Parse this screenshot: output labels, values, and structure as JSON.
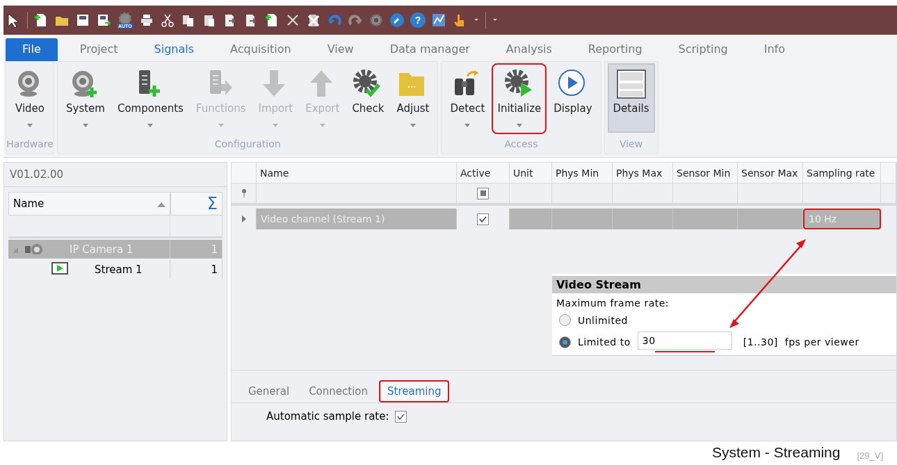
{
  "quick_access": {
    "auto_label": "AUTO",
    "help_label": "?"
  },
  "ribbon_tabs": [
    {
      "label": "File",
      "kind": "file",
      "selected": false
    },
    {
      "label": "Project",
      "kind": "tab",
      "selected": false
    },
    {
      "label": "Signals",
      "kind": "tab",
      "selected": true
    },
    {
      "label": "Acquisition",
      "kind": "tab",
      "selected": false
    },
    {
      "label": "View",
      "kind": "tab",
      "selected": false
    },
    {
      "label": "Data manager",
      "kind": "tab",
      "selected": false
    },
    {
      "label": "Analysis",
      "kind": "tab",
      "selected": false
    },
    {
      "label": "Reporting",
      "kind": "tab",
      "selected": false
    },
    {
      "label": "Scripting",
      "kind": "tab",
      "selected": false
    },
    {
      "label": "Info",
      "kind": "tab",
      "selected": false
    }
  ],
  "ribbon_groups": [
    {
      "label": "Hardware",
      "items": [
        {
          "label": "Video",
          "kind": "webcam",
          "dropdown": true,
          "disabled": false,
          "pressed": false,
          "highlighted": false
        }
      ]
    },
    {
      "label": "Configuration",
      "items": [
        {
          "label": "System",
          "kind": "webcam-add",
          "dropdown": true,
          "disabled": false,
          "pressed": false,
          "highlighted": false
        },
        {
          "label": "Components",
          "kind": "server-add",
          "dropdown": true,
          "disabled": false,
          "pressed": false,
          "highlighted": false
        },
        {
          "label": "Functions",
          "kind": "server-arrow",
          "dropdown": true,
          "disabled": true,
          "pressed": false,
          "highlighted": false
        },
        {
          "label": "Import",
          "kind": "arrow-down",
          "dropdown": true,
          "disabled": true,
          "pressed": false,
          "highlighted": false
        },
        {
          "label": "Export",
          "kind": "arrow-up",
          "dropdown": true,
          "disabled": true,
          "pressed": false,
          "highlighted": false
        },
        {
          "label": "Check",
          "kind": "gear-check",
          "dropdown": false,
          "disabled": false,
          "pressed": false,
          "highlighted": false
        },
        {
          "label": "Adjust",
          "kind": "folder",
          "dropdown": true,
          "disabled": false,
          "pressed": false,
          "highlighted": false
        }
      ]
    },
    {
      "label": "Access",
      "items": [
        {
          "label": "Detect",
          "kind": "binoculars",
          "dropdown": true,
          "disabled": false,
          "pressed": false,
          "highlighted": false
        },
        {
          "label": "Initialize",
          "kind": "gear-play",
          "dropdown": true,
          "disabled": false,
          "pressed": false,
          "highlighted": true
        },
        {
          "label": "Display",
          "kind": "play-circle",
          "dropdown": false,
          "disabled": false,
          "pressed": false,
          "highlighted": false
        }
      ]
    },
    {
      "label": "View",
      "items": [
        {
          "label": "Details",
          "kind": "details",
          "dropdown": false,
          "disabled": false,
          "pressed": true,
          "highlighted": false
        }
      ]
    }
  ],
  "tree": {
    "version": "V01.02.00",
    "name_column": "Name",
    "name_sorted_ascending": true,
    "count_column": "Σ",
    "rows": [
      {
        "name": "IP Camera 1",
        "count": "1",
        "kind": "camera",
        "selected": true,
        "expanded": true,
        "children": [
          {
            "name": "Stream 1",
            "count": "1",
            "kind": "stream",
            "selected": false
          }
        ]
      }
    ]
  },
  "channel_grid": {
    "columns": [
      "Name",
      "Active",
      "Unit",
      "Phys Min",
      "Phys Max",
      "Sensor Min",
      "Sensor Max",
      "Sampling rate"
    ],
    "active_filter_mixed": true,
    "rows": [
      {
        "name": "Video channel (Stream 1)",
        "active": true,
        "sampling_rate": "10 Hz",
        "selected": true,
        "sampling_rate_highlighted": true
      }
    ]
  },
  "video_stream_panel": {
    "title": "Video Stream",
    "label": "Maximum frame rate:",
    "options": [
      {
        "label": "Unlimited",
        "selected": false
      },
      {
        "label": "Limited to",
        "selected": true,
        "value": "30",
        "range": "[1..30]",
        "unit": "fps per viewer",
        "underlined": true
      }
    ]
  },
  "detail_tabs": [
    {
      "label": "General",
      "selected": false,
      "highlighted": false
    },
    {
      "label": "Connection",
      "selected": false,
      "highlighted": false
    },
    {
      "label": "Streaming",
      "selected": true,
      "highlighted": true
    }
  ],
  "detail_fields": [
    {
      "label": "Automatic sample rate:",
      "checked": true
    }
  ],
  "caption": {
    "title": "System - Streaming",
    "code": "[29_V]"
  }
}
